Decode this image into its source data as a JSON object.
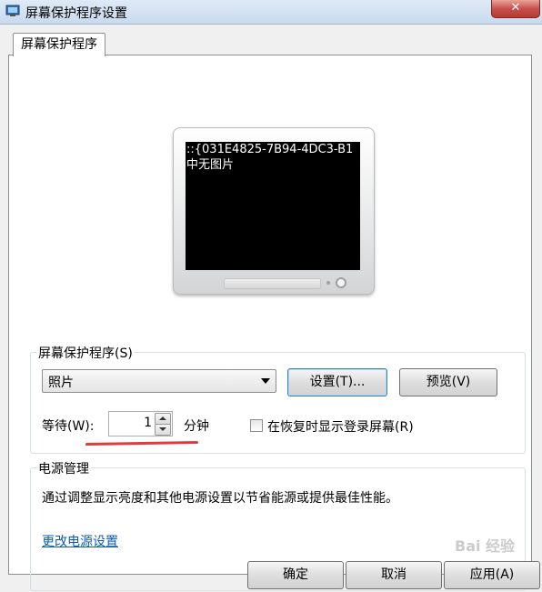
{
  "window": {
    "title": "屏幕保护程序设置",
    "close_label": "✕"
  },
  "tabs": [
    {
      "label": "屏幕保护程序"
    }
  ],
  "preview": {
    "lines": [
      "::{031E4825-7B94-4DC3-B1",
      "中无图片"
    ]
  },
  "screensaver": {
    "group_label": "屏幕保护程序(S)",
    "selected": "照片",
    "settings_label": "设置(T)...",
    "preview_label": "预览(V)",
    "wait_label": "等待(W):",
    "wait_value": "1",
    "wait_unit": "分钟",
    "resume_label": "在恢复时显示登录屏幕(R)",
    "resume_checked": false
  },
  "power": {
    "group_label": "电源管理",
    "description": "通过调整显示亮度和其他电源设置以节省能源或提供最佳性能。",
    "link": "更改电源设置"
  },
  "buttons": {
    "ok": "确定",
    "cancel": "取消",
    "apply": "应用(A)"
  },
  "watermark": "Bai 经验"
}
